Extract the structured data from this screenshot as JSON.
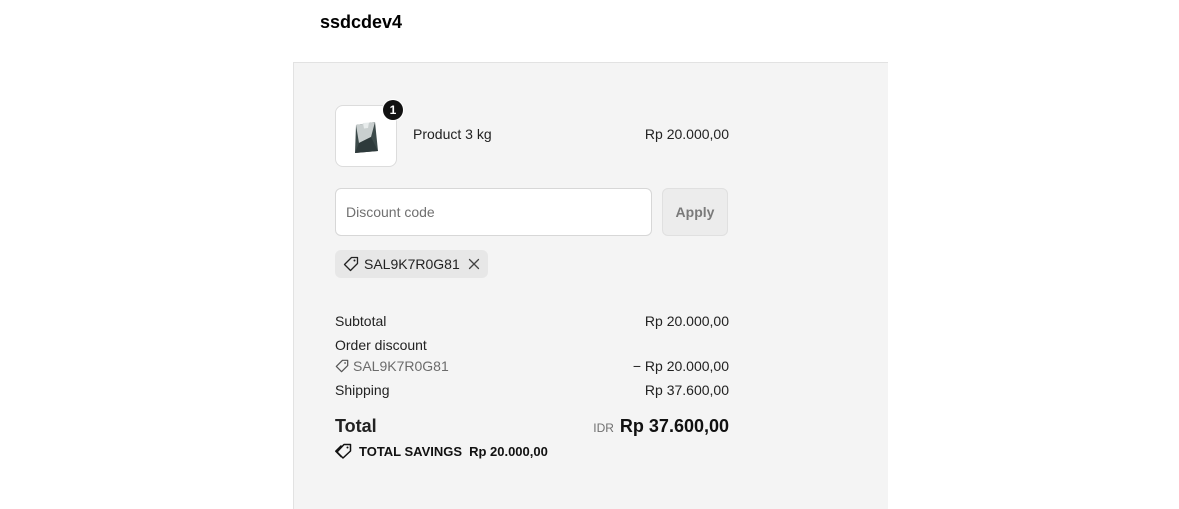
{
  "store": {
    "name": "ssdcdev4"
  },
  "cart": {
    "items": [
      {
        "quantity": "1",
        "name": "Product 3 kg",
        "price": "Rp 20.000,00",
        "thumbnail_icon": "product-bag-icon"
      }
    ]
  },
  "discount": {
    "placeholder": "Discount code",
    "value": "",
    "apply_label": "Apply",
    "applied_code": "SAL9K7R0G81"
  },
  "summary": {
    "subtotal_label": "Subtotal",
    "subtotal_value": "Rp 20.000,00",
    "order_discount_label": "Order discount",
    "order_discount_code": "SAL9K7R0G81",
    "order_discount_value": "− Rp 20.000,00",
    "shipping_label": "Shipping",
    "shipping_value": "Rp 37.600,00",
    "total_label": "Total",
    "currency": "IDR",
    "total_value": "Rp 37.600,00",
    "savings_label": "TOTAL SAVINGS",
    "savings_value": "Rp 20.000,00"
  },
  "colors": {
    "panel_background": "#f4f4f4",
    "badge_background": "#111111",
    "apply_button_disabled": "#ececec"
  }
}
